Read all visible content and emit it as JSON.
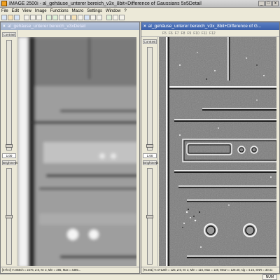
{
  "app": {
    "title": "IMAGE 2500i - al_gehäuse_unterer bereich_v3x_8bit+Difference of Gaussians 5x5Detail",
    "controls": {
      "min": "_",
      "max": "□",
      "close": "x"
    }
  },
  "menu": [
    "File",
    "Edit",
    "View",
    "Image",
    "Functions",
    "Macro",
    "Settings",
    "Window",
    "?"
  ],
  "left_window": {
    "title": "al_gehäuse_unterer bereich_v3xDetail",
    "contrast_label": "Contrast",
    "contrast_value": "1.00",
    "brightness_label": "Brightness",
    "status": "[57h.0] V=858ch = 2276, Z:0, M: 2, Min = 285, Max = 4385..."
  },
  "right_window": {
    "title": "al_gehäuse_unterer bereich_v3x_8bit+Difference of G...",
    "fkeys": [
      "F5",
      "F6",
      "F7",
      "F8",
      "F9",
      "F10",
      "F11",
      "F12"
    ],
    "contrast_label": "Contrast",
    "contrast_value": "1.00",
    "brightness_label": "Brightness",
    "status": "[76.461] V=0*128h = 125, Z:0, M: 2, Min = 116, Max = 138, Mean = 128.40, sig = 4.15, SNR = 30.41"
  },
  "app_status": {
    "num": "NUM"
  },
  "colors": {
    "active_title": "#3a5ea8",
    "inactive_title": "#9fb0cc",
    "chrome": "#ece9d8"
  }
}
